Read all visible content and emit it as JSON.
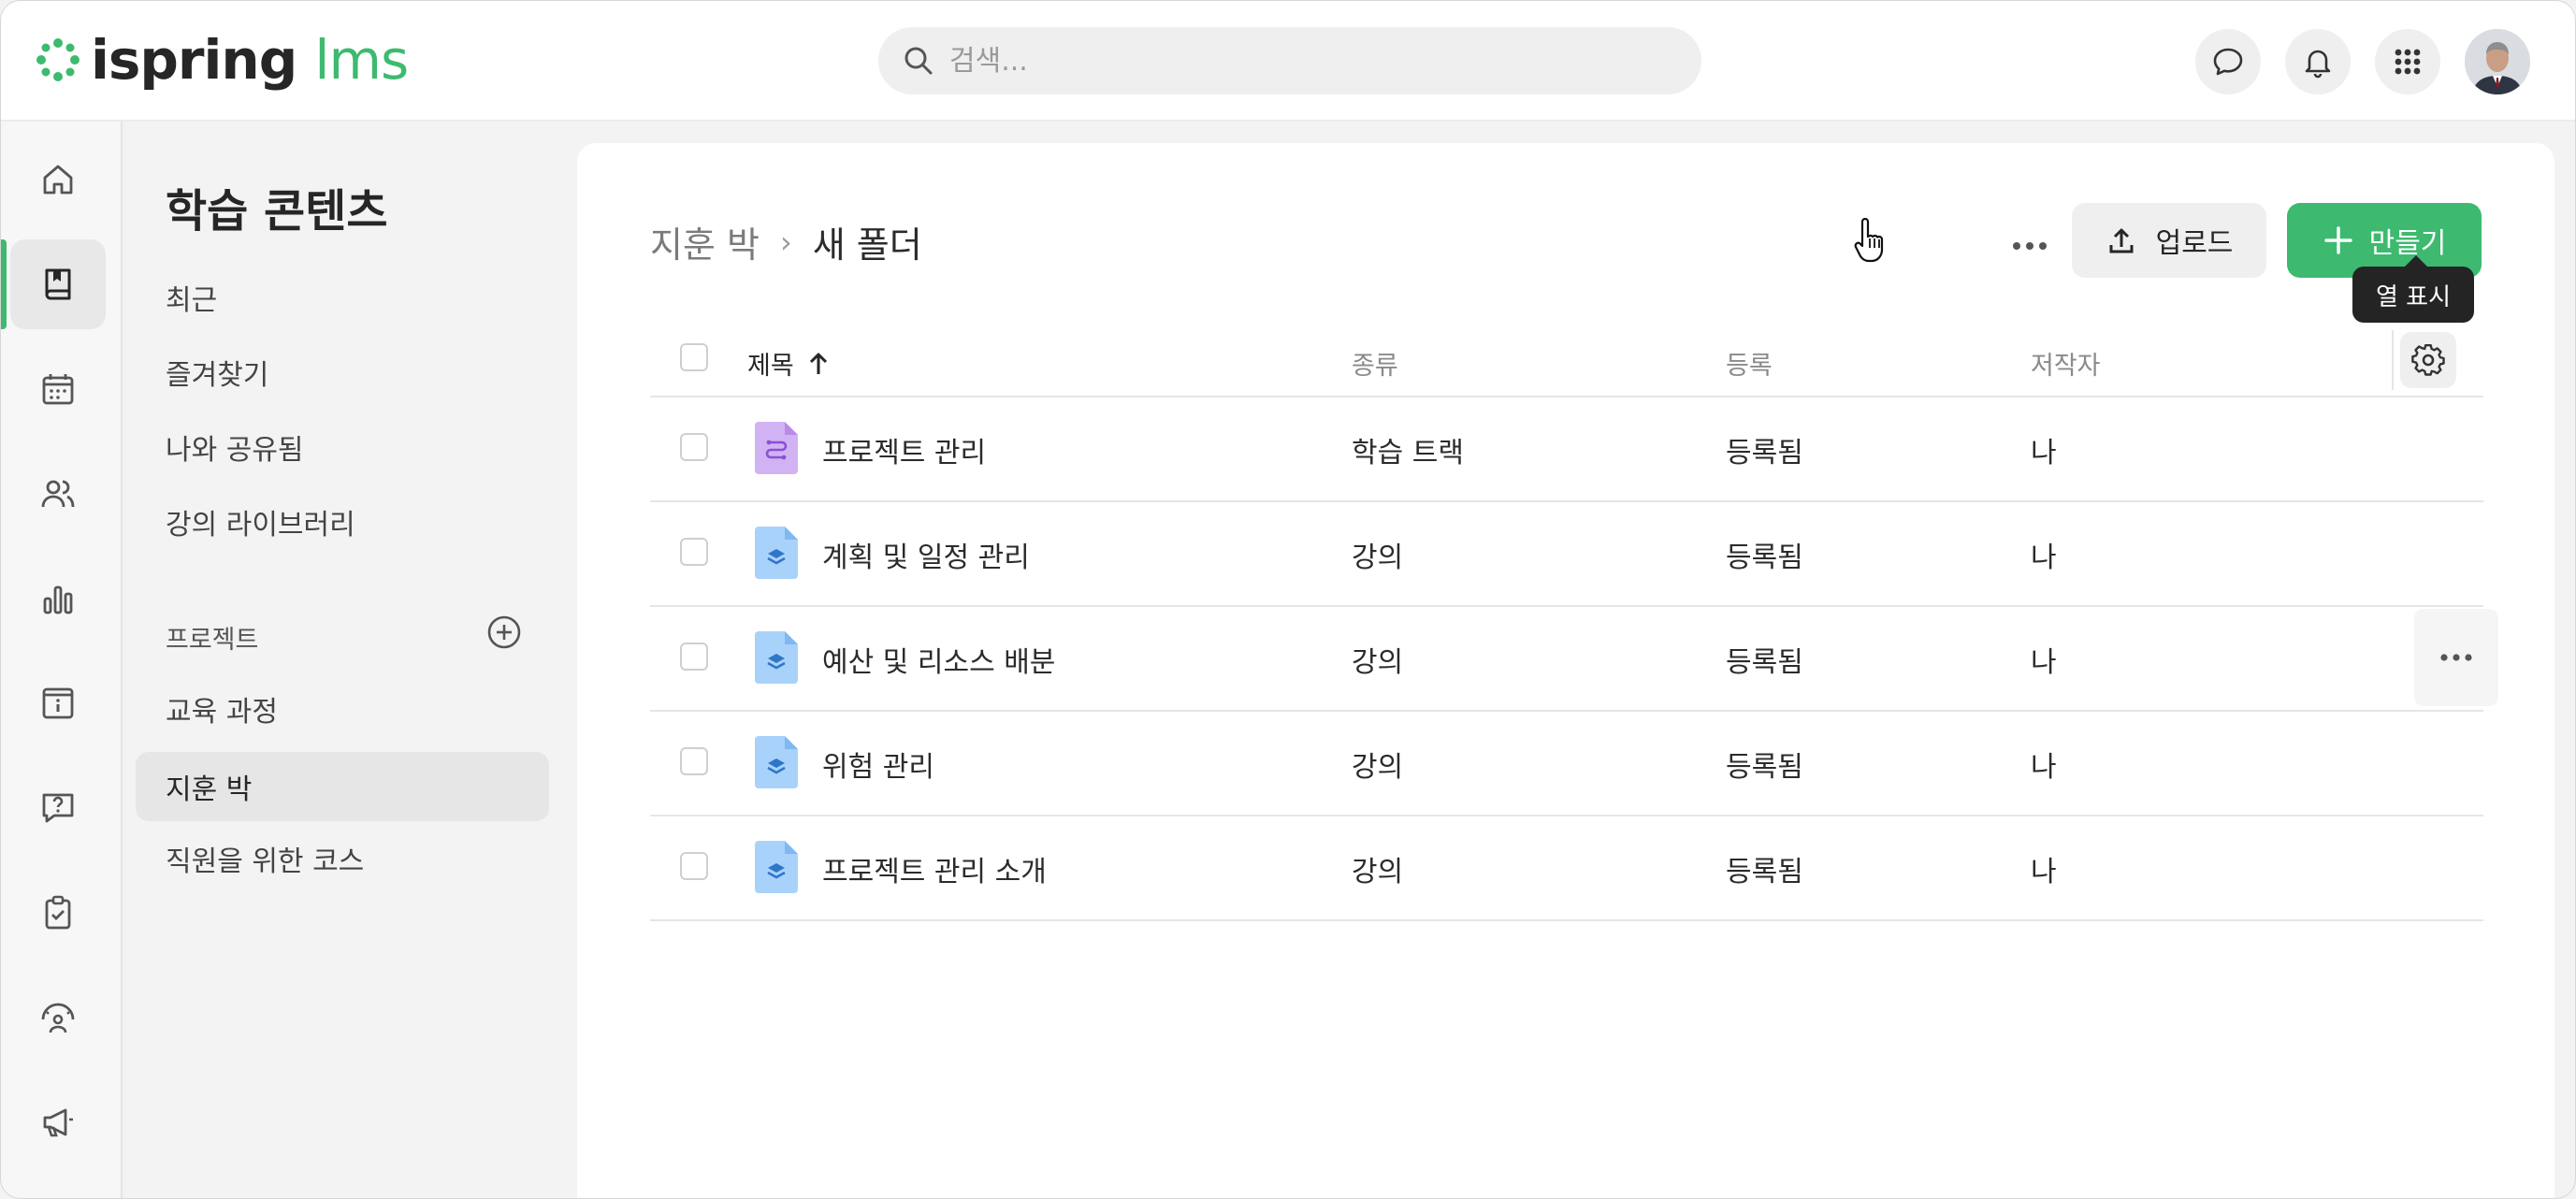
{
  "app": {
    "logo_main": "ispring",
    "logo_suffix": "lms",
    "brand_color": "#3dba6f"
  },
  "search": {
    "placeholder": "검색..."
  },
  "header_icons": [
    "chat-bubble-icon",
    "bell-icon",
    "apps-grid-icon",
    "user-avatar"
  ],
  "rail": {
    "items": [
      "home-icon",
      "book-icon",
      "calendar-icon",
      "users-icon",
      "bar-chart-icon",
      "info-board-icon",
      "question-chat-icon",
      "clipboard-check-icon",
      "gauge-person-icon",
      "megaphone-icon"
    ],
    "active_index": 1
  },
  "sidebar": {
    "title": "학습 콘텐츠",
    "items": [
      "최근",
      "즐겨찾기",
      "나와 공유됨",
      "강의 라이브러리"
    ],
    "section_label": "프로젝트",
    "projects": [
      "교육 과정",
      "지훈 박",
      "직원을 위한 코스"
    ],
    "active_project_index": 1
  },
  "breadcrumb": {
    "root": "지훈 박",
    "separator": "›",
    "current": "새 폴더"
  },
  "toolbar": {
    "upload_label": "업로드",
    "create_label": "만들기",
    "tooltip": "열 표시"
  },
  "table": {
    "columns": {
      "title": "제목",
      "type": "종류",
      "status": "등록",
      "author": "저작자"
    },
    "rows": [
      {
        "title": "프로젝트 관리",
        "type": "학습 트랙",
        "status": "등록됨",
        "author": "나",
        "icon": "learning-track-icon"
      },
      {
        "title": "계획 및 일정 관리",
        "type": "강의",
        "status": "등록됨",
        "author": "나",
        "icon": "course-file-icon"
      },
      {
        "title": "예산 및 리소스 배분",
        "type": "강의",
        "status": "등록됨",
        "author": "나",
        "icon": "course-file-icon"
      },
      {
        "title": "위험 관리",
        "type": "강의",
        "status": "등록됨",
        "author": "나",
        "icon": "course-file-icon"
      },
      {
        "title": "프로젝트 관리 소개",
        "type": "강의",
        "status": "등록됨",
        "author": "나",
        "icon": "course-file-icon"
      }
    ],
    "hovered_row_index": 2
  }
}
